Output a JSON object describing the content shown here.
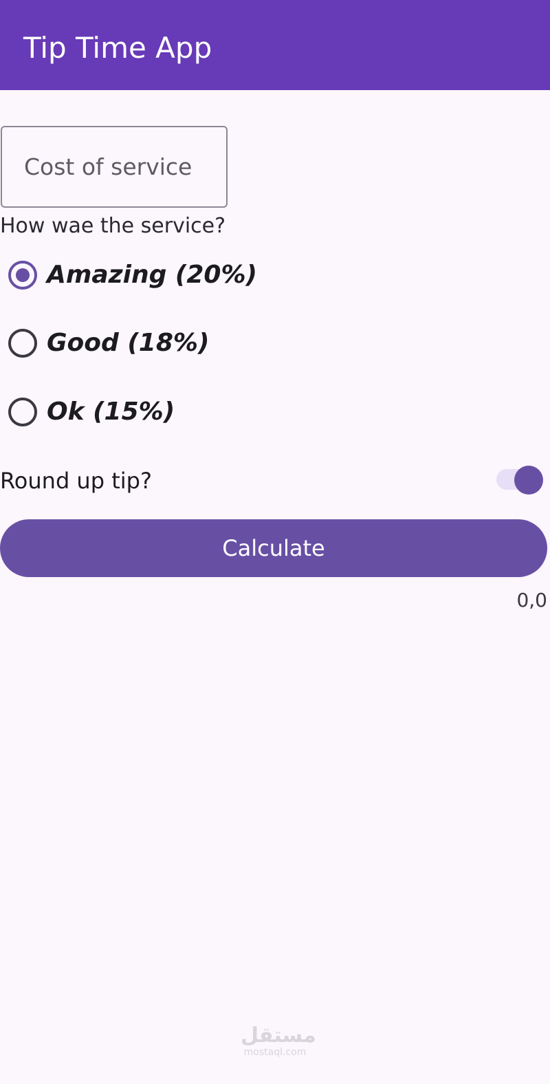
{
  "app_bar": {
    "title": "Tip Time App",
    "color": "#673ab7"
  },
  "cost_input": {
    "placeholder": "Cost of service",
    "value": ""
  },
  "service_question": "How wae the service?",
  "tip_options": [
    {
      "label": "Amazing (20%)",
      "selected": true
    },
    {
      "label": "Good (18%)",
      "selected": false
    },
    {
      "label": "Ok (15%)",
      "selected": false
    }
  ],
  "round_up": {
    "label": "Round up tip?",
    "enabled": true
  },
  "calculate_button": {
    "label": "Calculate",
    "color": "#6750a4"
  },
  "tip_amount": "0,0",
  "watermark": {
    "text": "مستقل",
    "url": "mostaql.com"
  }
}
